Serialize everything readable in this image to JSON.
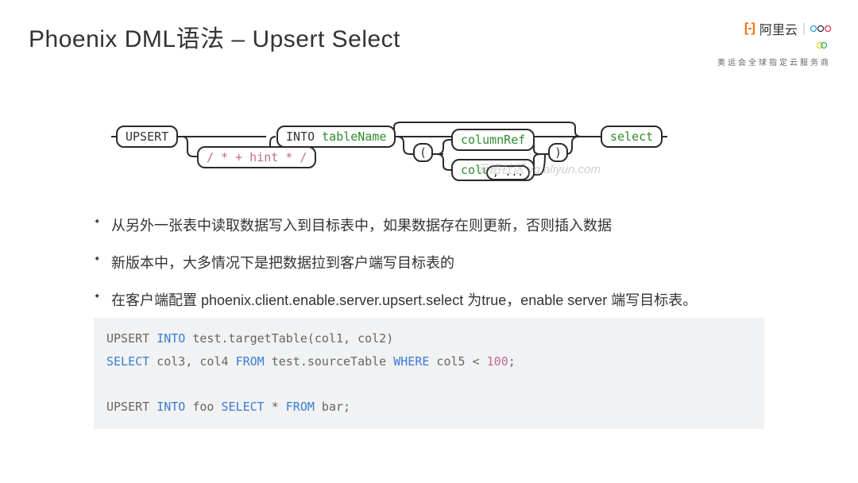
{
  "title": "Phoenix DML语法 – Upsert Select",
  "brand": {
    "logo": "[-]",
    "name": "阿里云",
    "sub": "奥运会全球指定云服务商"
  },
  "diagram": {
    "upsert": "UPSERT",
    "hint": "/ * + hint * /",
    "into": "INTO",
    "tableName": "tableName",
    "lparen": "(",
    "columnRef": "columnRef",
    "columnDef": "columnDef",
    "comma": ", ...",
    "rparen": ")",
    "select": "select"
  },
  "watermark": "云栖社区 yq.aliyun.com",
  "bullets": [
    "从另外一张表中读取数据写入到目标表中，如果数据存在则更新，否则插入数据",
    "新版本中，大多情况下是把数据拉到客户端写目标表的",
    "在客户端配置 phoenix.client.enable.server.upsert.select 为true，enable server 端写目标表。"
  ],
  "code": {
    "l1a": "UPSERT ",
    "l1b": "INTO",
    "l1c": " test.targetTable(col1, col2)",
    "l2a": "SELECT",
    "l2b": " col3, col4 ",
    "l2c": "FROM",
    "l2d": " test.sourceTable ",
    "l2e": "WHERE",
    "l2f": " col5 < ",
    "l2g": "100",
    "l2h": ";",
    "l3": "",
    "l4a": "UPSERT ",
    "l4b": "INTO",
    "l4c": " foo ",
    "l4d": "SELECT",
    "l4e": " * ",
    "l4f": "FROM",
    "l4g": " bar;"
  }
}
